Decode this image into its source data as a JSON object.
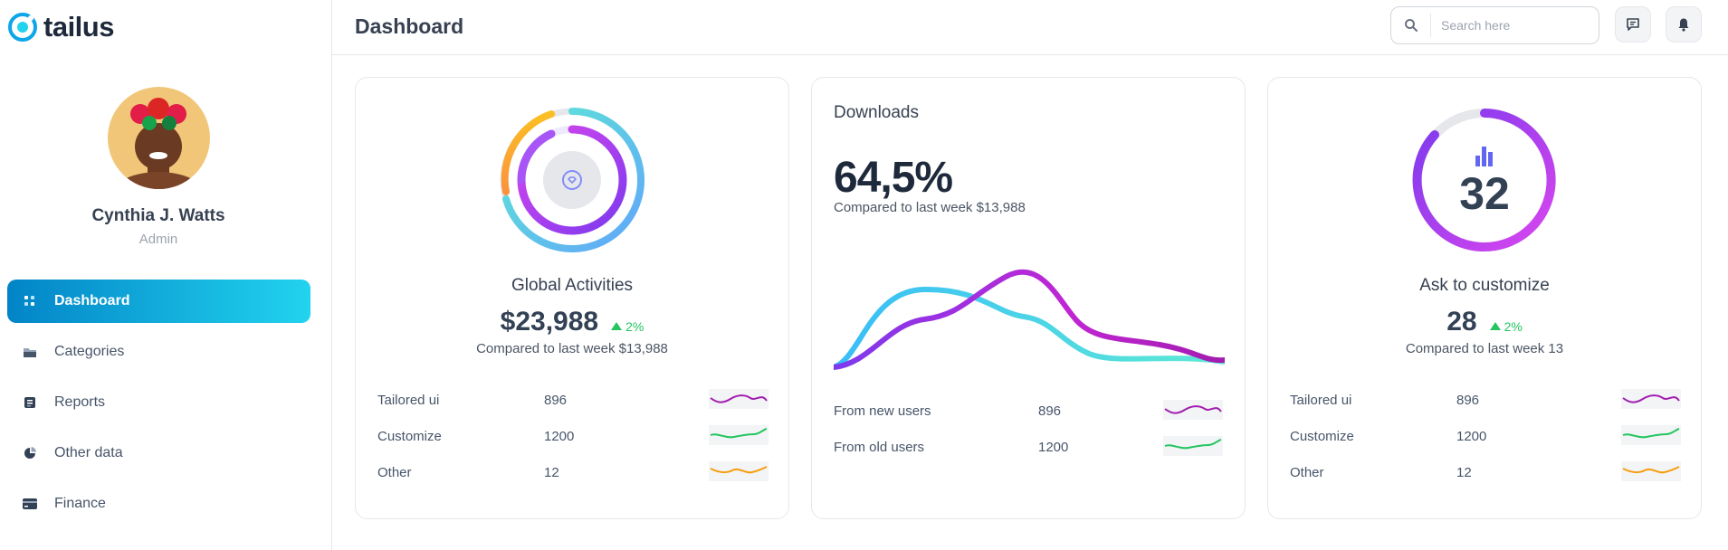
{
  "brand": {
    "name": "tailus"
  },
  "user": {
    "name": "Cynthia J. Watts",
    "role": "Admin"
  },
  "nav": [
    {
      "label": "Dashboard",
      "icon": "grid-icon",
      "active": true
    },
    {
      "label": "Categories",
      "icon": "folder-icon"
    },
    {
      "label": "Reports",
      "icon": "report-icon"
    },
    {
      "label": "Other data",
      "icon": "pie-chart-icon"
    },
    {
      "label": "Finance",
      "icon": "credit-card-icon"
    }
  ],
  "header": {
    "title": "Dashboard",
    "search_placeholder": "Search here"
  },
  "global": {
    "title": "Global Activities",
    "value": "$23,988",
    "delta": "2%",
    "compare": "Compared to last week $13,988",
    "rows": [
      {
        "label": "Tailored ui",
        "value": "896",
        "color": "#a21caf"
      },
      {
        "label": "Customize",
        "value": "1200",
        "color": "#22c55e"
      },
      {
        "label": "Other",
        "value": "12",
        "color": "#f59e0b"
      }
    ]
  },
  "downloads": {
    "title": "Downloads",
    "value": "64,5%",
    "compare": "Compared to last week $13,988",
    "rows": [
      {
        "label": "From new users",
        "value": "896",
        "color": "#a21caf"
      },
      {
        "label": "From old users",
        "value": "1200",
        "color": "#22c55e"
      }
    ]
  },
  "customize": {
    "title": "Ask to customize",
    "ring_value": "32",
    "value": "28",
    "delta": "2%",
    "compare": "Compared to last week 13",
    "rows": [
      {
        "label": "Tailored ui",
        "value": "896",
        "color": "#a21caf"
      },
      {
        "label": "Customize",
        "value": "1200",
        "color": "#22c55e"
      },
      {
        "label": "Other",
        "value": "12",
        "color": "#f59e0b"
      }
    ]
  },
  "colors": {
    "accent_start": "#0284c7",
    "accent_end": "#22d3ee",
    "positive": "#22c55e"
  }
}
